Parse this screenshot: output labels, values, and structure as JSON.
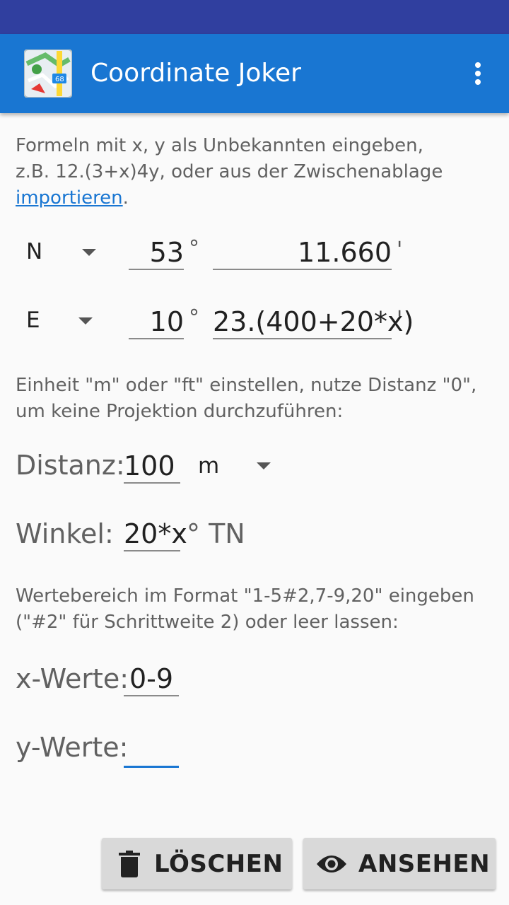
{
  "app": {
    "title": "Coordinate Joker",
    "icon": "app-map-icon",
    "menu_icon": "overflow-menu-icon",
    "colors": {
      "primary": "#1976d2",
      "primary_dark": "#303f9f",
      "accent": "#1976d2"
    }
  },
  "intro": {
    "line1": "Formeln mit x, y als Unbekannten eingeben,",
    "line2": "z.B. 12.(3+x)4y, oder aus der Zwischenablage",
    "link": "importieren",
    "after_link": "."
  },
  "coord": {
    "lat": {
      "hemisphere": "N",
      "degrees": "53",
      "deg_symbol": "°",
      "minutes": "11.660",
      "min_symbol": "'"
    },
    "lon": {
      "hemisphere": "E",
      "degrees": "10",
      "deg_symbol": "°",
      "minutes": "23.(400+20*x)",
      "min_symbol": "'"
    }
  },
  "projection": {
    "hint_line1": "Einheit \"m\" oder \"ft\" einstellen, nutze Distanz \"0\",",
    "hint_line2": "um keine Projektion durchzuführen:",
    "distance_label": "Distanz:",
    "distance_value": "100",
    "distance_unit": "m",
    "angle_label": "Winkel:",
    "angle_value": "20*x",
    "angle_unit": "° TN"
  },
  "ranges": {
    "hint_line1": "Wertebereich im Format \"1-5#2,7-9,20\" eingeben",
    "hint_line2": "(\"#2\" für Schrittweite 2) oder leer lassen:",
    "x_label": "x-Werte:",
    "x_value": "0-9",
    "y_label": "y-Werte:",
    "y_value": ""
  },
  "buttons": {
    "clear": {
      "label": "LÖSCHEN",
      "icon": "trash-icon"
    },
    "view": {
      "label": "ANSEHEN",
      "icon": "eye-icon"
    }
  }
}
